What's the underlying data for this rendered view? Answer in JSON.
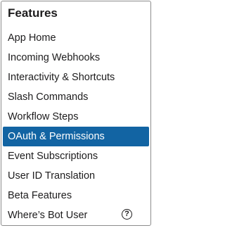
{
  "sidebar": {
    "title": "Features",
    "items": [
      {
        "label": "App Home",
        "active": false
      },
      {
        "label": "Incoming Webhooks",
        "active": false
      },
      {
        "label": "Interactivity & Shortcuts",
        "active": false
      },
      {
        "label": "Slash Commands",
        "active": false
      },
      {
        "label": "Workflow Steps",
        "active": false
      },
      {
        "label": "OAuth & Permissions",
        "active": true
      },
      {
        "label": "Event Subscriptions",
        "active": false
      },
      {
        "label": "User ID Translation",
        "active": false
      },
      {
        "label": "Beta Features",
        "active": false
      },
      {
        "label": "Where’s Bot User",
        "active": false,
        "icon": "help-icon",
        "icon_glyph": "?"
      }
    ]
  },
  "colors": {
    "active_background": "#1264a3",
    "active_text": "#ffffff",
    "text": "#1d1c1d",
    "border": "#8d8d8d"
  }
}
